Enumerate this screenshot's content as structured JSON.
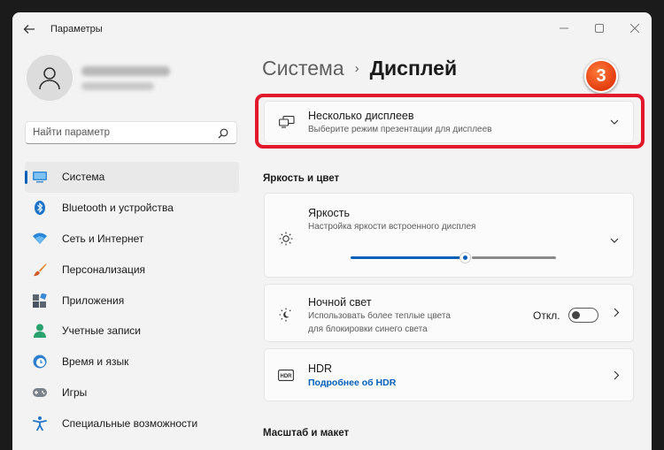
{
  "window": {
    "title": "Параметры"
  },
  "search": {
    "placeholder": "Найти параметр"
  },
  "sidebar": {
    "items": [
      {
        "label": "Система",
        "icon": "monitor-icon"
      },
      {
        "label": "Bluetooth и устройства",
        "icon": "bluetooth-icon"
      },
      {
        "label": "Сеть и Интернет",
        "icon": "wifi-icon"
      },
      {
        "label": "Персонализация",
        "icon": "brush-icon"
      },
      {
        "label": "Приложения",
        "icon": "apps-icon"
      },
      {
        "label": "Учетные записи",
        "icon": "person-icon"
      },
      {
        "label": "Время и язык",
        "icon": "globe-clock-icon"
      },
      {
        "label": "Игры",
        "icon": "gamepad-icon"
      },
      {
        "label": "Специальные возможности",
        "icon": "accessibility-icon"
      }
    ]
  },
  "breadcrumb": {
    "parent": "Система",
    "separator": "›",
    "current": "Дисплей"
  },
  "step_badge": "3",
  "multi_display": {
    "title": "Несколько дисплеев",
    "subtitle": "Выберите режим презентации для дисплеев"
  },
  "section_brightness": "Яркость и цвет",
  "brightness": {
    "title": "Яркость",
    "subtitle": "Настройка яркости встроенного дисплея",
    "level_fraction": 0.55
  },
  "night_light": {
    "title": "Ночной свет",
    "subtitle_line1": "Использовать более теплые цвета",
    "subtitle_line2": "для блокировки синего света",
    "state_label": "Откл.",
    "enabled": false
  },
  "hdr": {
    "title": "HDR",
    "link": "Подробнее об HDR"
  },
  "section_scale": "Масштаб и макет",
  "colors": {
    "accent": "#005fb8",
    "highlight": "#e1192b",
    "badge": "#e8501c"
  }
}
